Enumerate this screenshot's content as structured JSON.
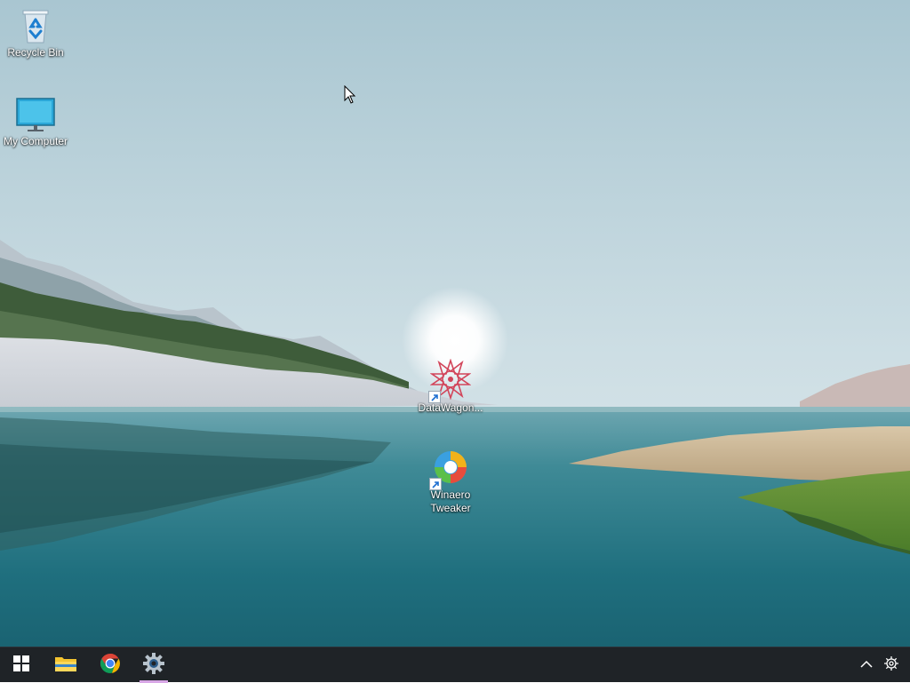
{
  "desktop": {
    "icons": [
      {
        "label": "Recycle Bin",
        "icon": "recycle-bin-icon"
      },
      {
        "label": "My Computer",
        "icon": "monitor-icon"
      },
      {
        "label": "DataWagon...",
        "icon": "datawagon-icon",
        "shortcut": true
      },
      {
        "label": "Winaero Tweaker",
        "icon": "winaero-tweaker-icon",
        "shortcut": true
      }
    ]
  },
  "taskbar": {
    "pinned": [
      {
        "name": "Start",
        "icon": "windows-logo-icon"
      },
      {
        "name": "File Explorer",
        "icon": "folder-icon"
      },
      {
        "name": "Google Chrome",
        "icon": "chrome-icon"
      },
      {
        "name": "Settings",
        "icon": "settings-gear-icon",
        "active": true
      }
    ],
    "tray": [
      {
        "icon": "chevron-up-icon"
      },
      {
        "icon": "gear-icon"
      }
    ]
  },
  "colors": {
    "taskbar_bg": "#1f2327",
    "active_indicator": "#d8a7e6",
    "label_text": "#ffffff"
  }
}
